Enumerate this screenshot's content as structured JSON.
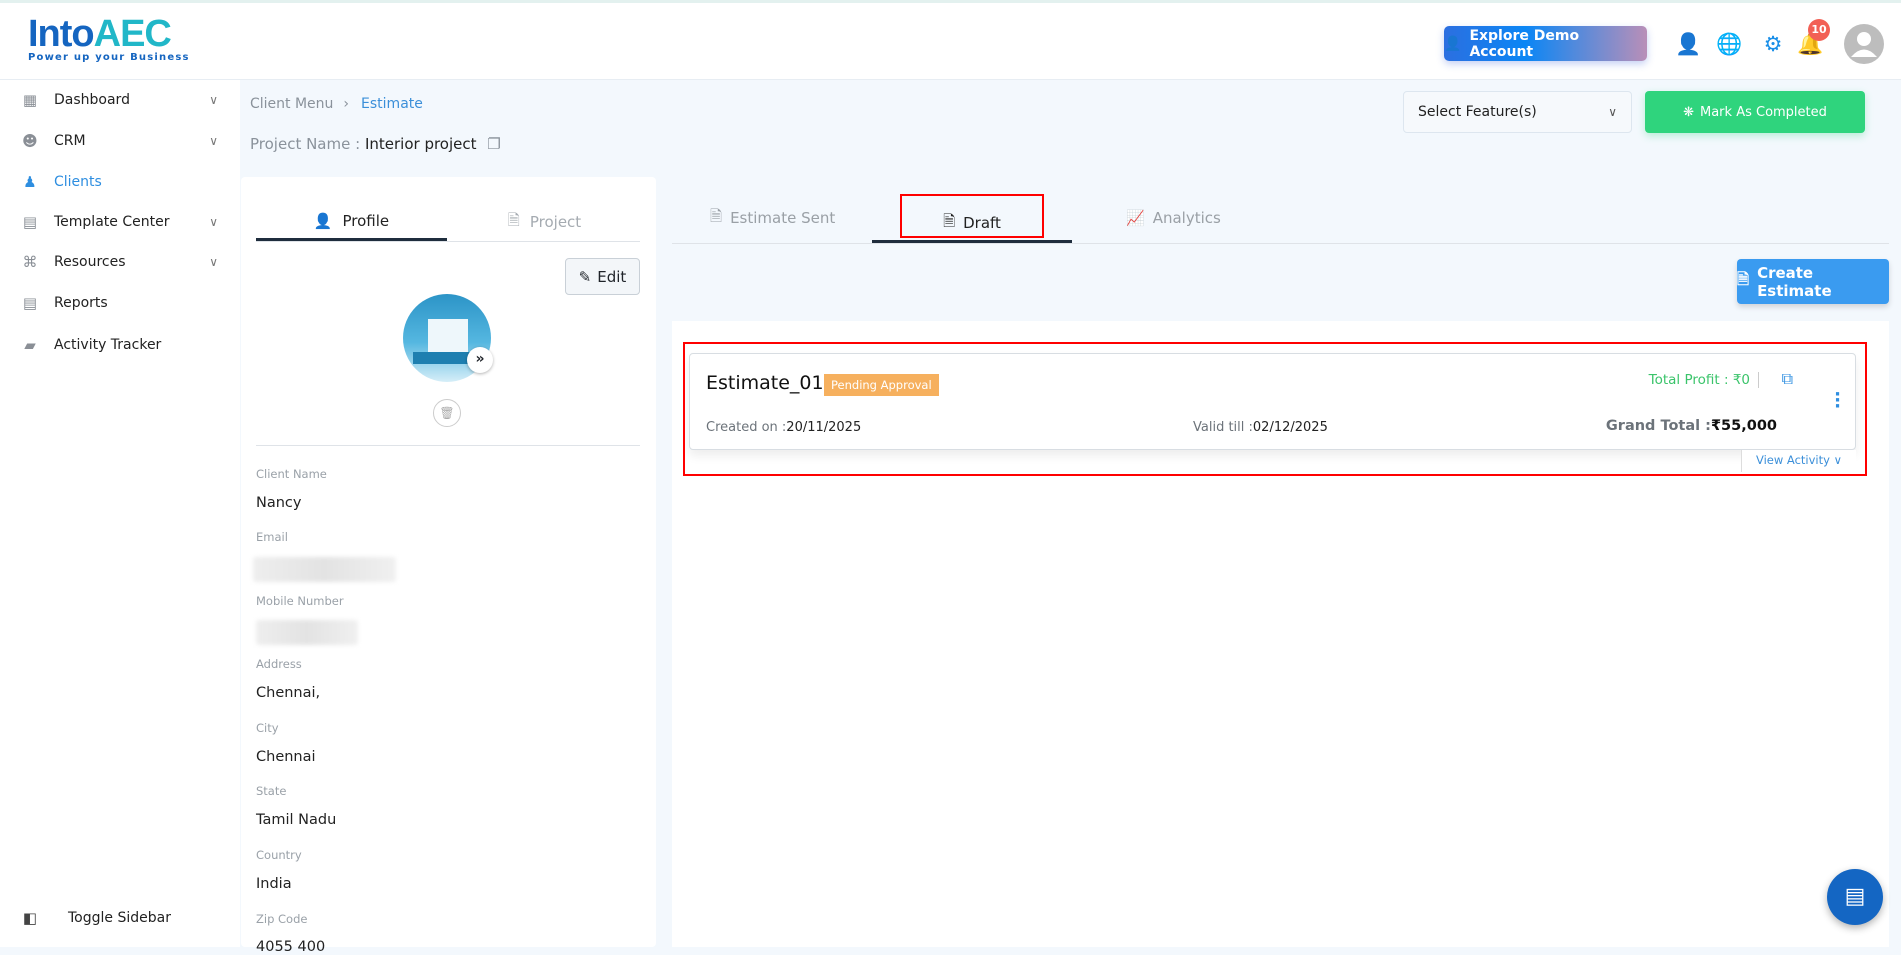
{
  "header": {
    "logo_text": "IntoAEC",
    "logo_tagline": "Power up your Business",
    "explore_demo_label": "Explore Demo Account",
    "notification_count": "10"
  },
  "sidebar": {
    "items": [
      {
        "label": "Dashboard",
        "icon": "dashboard-icon",
        "has_chevron": true
      },
      {
        "label": "CRM",
        "icon": "crm-icon",
        "has_chevron": true
      },
      {
        "label": "Clients",
        "icon": "clients-icon",
        "active": true
      },
      {
        "label": "Template Center",
        "icon": "template-icon",
        "has_chevron": true
      },
      {
        "label": "Resources",
        "icon": "resources-icon",
        "has_chevron": true
      },
      {
        "label": "Reports",
        "icon": "reports-icon"
      },
      {
        "label": "Activity Tracker",
        "icon": "activity-icon"
      }
    ],
    "toggle_label": "Toggle Sidebar"
  },
  "breadcrumb": {
    "parent": "Client Menu",
    "current": "Estimate"
  },
  "project": {
    "label": "Project Name :",
    "name": "Interior project"
  },
  "toolbar": {
    "select_placeholder": "Select Feature(s)",
    "mark_completed_label": "Mark As Completed"
  },
  "profile_panel": {
    "tabs": [
      "Profile",
      "Project"
    ],
    "edit_label": "Edit",
    "fields": [
      {
        "label": "Client Name",
        "value": "Nancy"
      },
      {
        "label": "Email",
        "value": ""
      },
      {
        "label": "Mobile Number",
        "value": ""
      },
      {
        "label": "Address",
        "value": "Chennai,"
      },
      {
        "label": "City",
        "value": "Chennai"
      },
      {
        "label": "State",
        "value": "Tamil Nadu"
      },
      {
        "label": "Country",
        "value": "India"
      },
      {
        "label": "Zip Code",
        "value": "4055 400"
      }
    ]
  },
  "estimate_tabs": [
    "Estimate Sent",
    "Draft",
    "Analytics"
  ],
  "create_estimate_label": "Create Estimate",
  "estimate": {
    "name": "Estimate_01",
    "status": "Pending Approval",
    "total_profit_label": "Total Profit :",
    "total_profit": "₹0",
    "created_label": "Created on :",
    "created": "20/11/2025",
    "valid_label": "Valid till :",
    "valid": "02/12/2025",
    "grand_total_label": "Grand Total :",
    "grand_total": "₹55,000",
    "view_activity_label": "View Activity"
  },
  "colors": {
    "accent": "#2e8ee0",
    "success": "#2fd47d",
    "pending": "#f6b05e",
    "highlight": "#ff0000"
  }
}
